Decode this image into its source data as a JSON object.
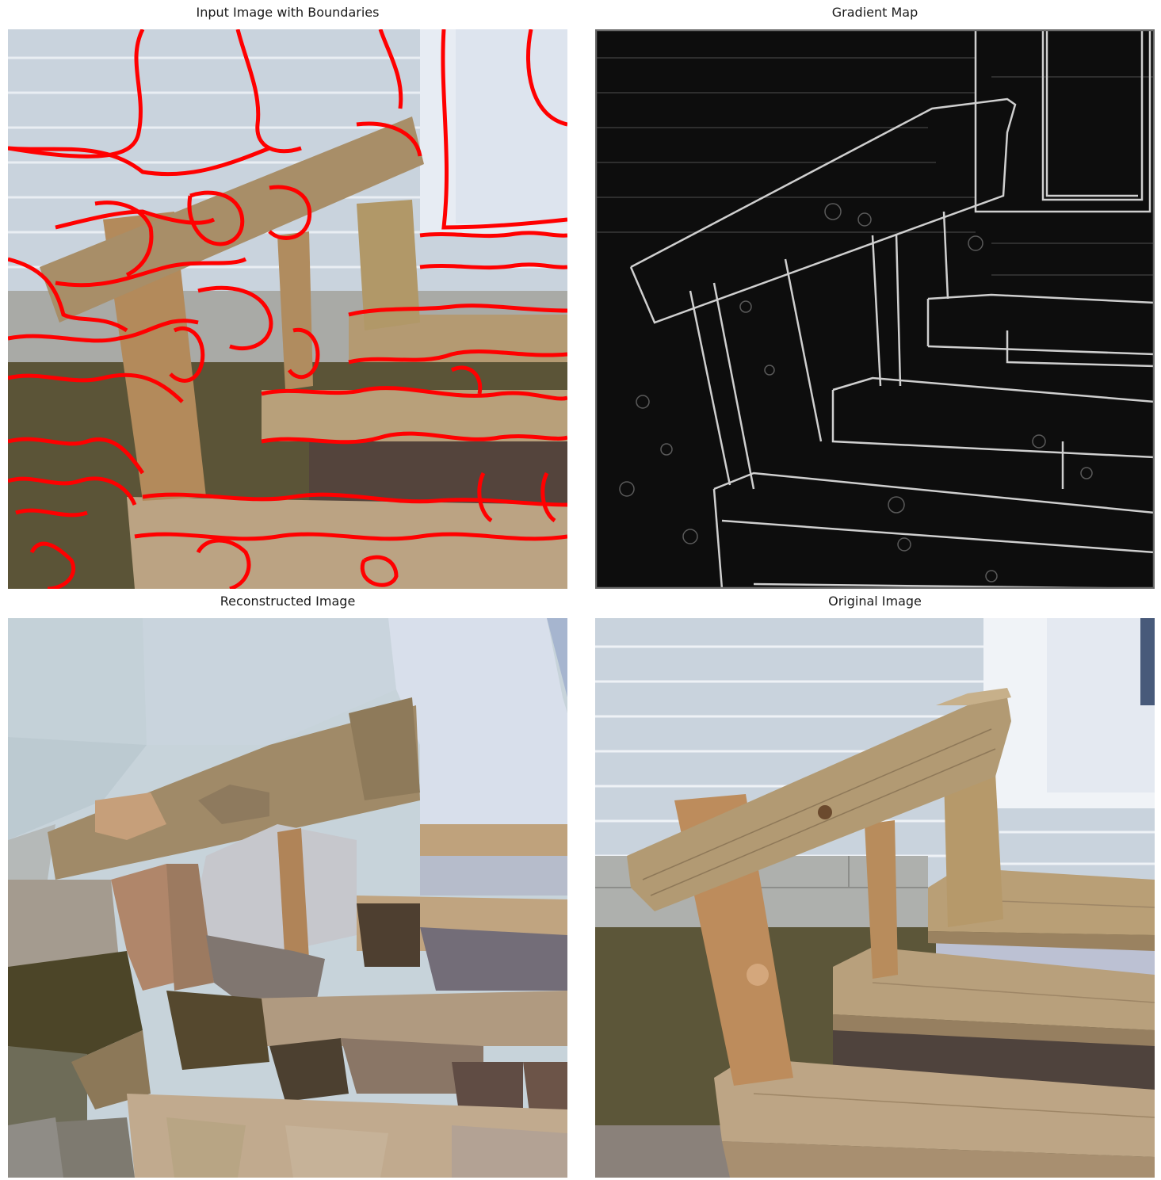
{
  "figure": {
    "panels": [
      {
        "title": "Input Image with Boundaries"
      },
      {
        "title": "Gradient Map"
      },
      {
        "title": "Reconstructed Image"
      },
      {
        "title": "Original Image"
      }
    ]
  },
  "colors": {
    "boundary": "#ff0000",
    "siding": "#c8d2dc",
    "wood": "#b49a72",
    "grass": "#5e5a3a",
    "gradient_background": "#0d0d0d",
    "gradient_edge": "#cfcfcf"
  }
}
